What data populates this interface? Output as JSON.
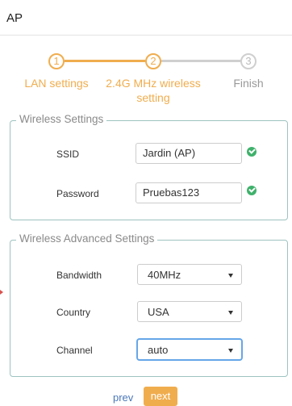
{
  "header": {
    "title": "AP"
  },
  "steps": [
    {
      "number": "1",
      "label": "LAN settings"
    },
    {
      "number": "2",
      "label": "2.4G MHz wireless setting"
    },
    {
      "number": "3",
      "label": "Finish"
    }
  ],
  "wireless_settings": {
    "legend": "Wireless Settings",
    "ssid_label": "SSID",
    "ssid_value": "Jardin (AP)",
    "password_label": "Password",
    "password_value": "Pruebas123"
  },
  "advanced_settings": {
    "legend": "Wireless Advanced Settings",
    "bandwidth_label": "Bandwidth",
    "bandwidth_value": "40MHz",
    "country_label": "Country",
    "country_value": "USA",
    "channel_label": "Channel",
    "channel_value": "auto"
  },
  "buttons": {
    "prev": "prev",
    "next": "next"
  },
  "colors": {
    "accent": "#f0ad4e",
    "border": "#9dc3c0",
    "success": "#3fb16b",
    "link": "#4a78b8"
  }
}
